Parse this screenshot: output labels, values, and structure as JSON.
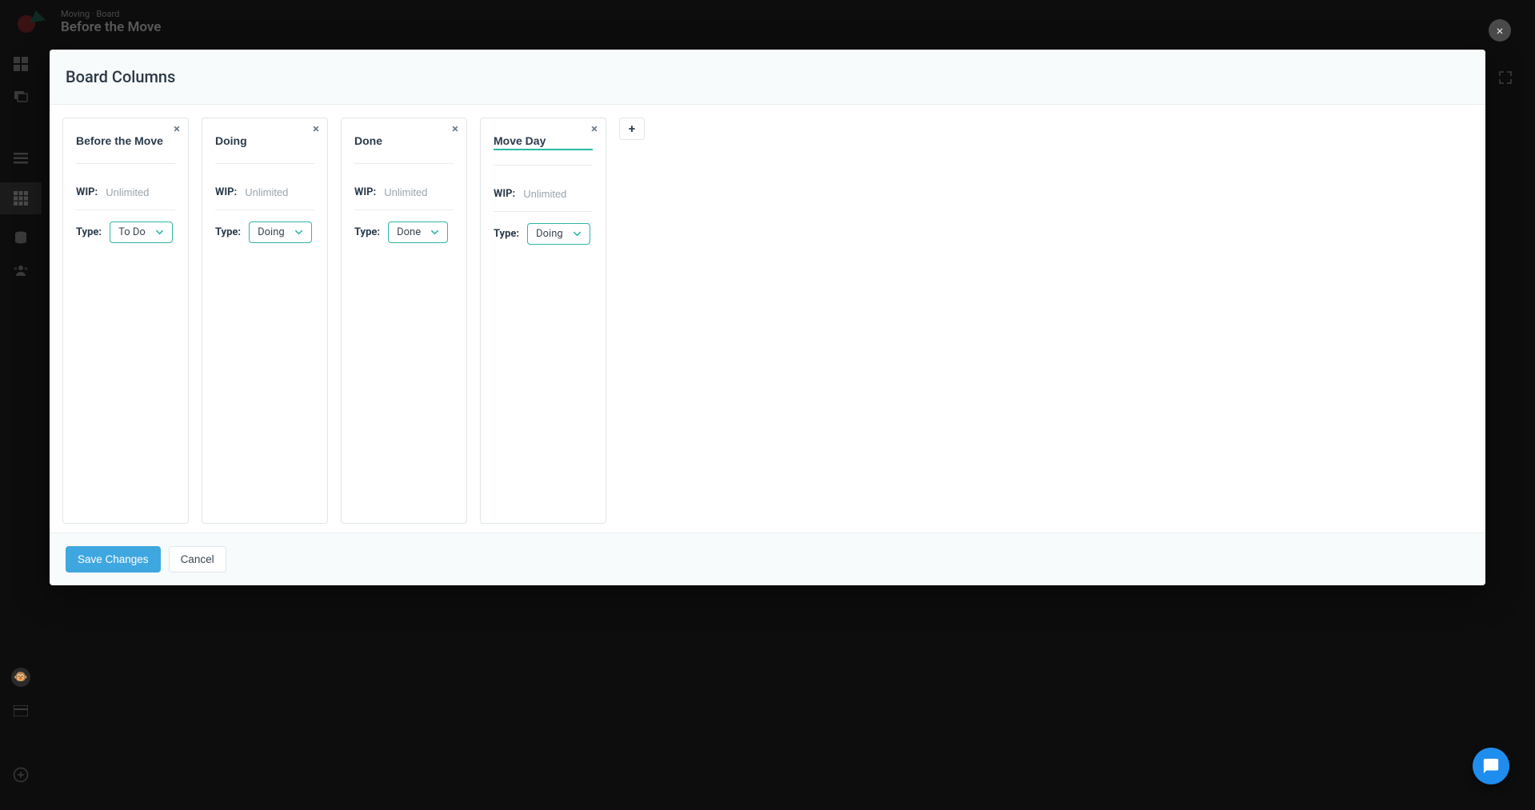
{
  "header": {
    "breadcrumb": "Moving · Board",
    "title": "Before the Move"
  },
  "modal": {
    "title": "Board Columns",
    "wip_label": "WIP:",
    "wip_placeholder": "Unlimited",
    "type_label": "Type:",
    "save_label": "Save Changes",
    "cancel_label": "Cancel"
  },
  "columns": [
    {
      "name": "Before the Move",
      "wip": "",
      "type": "To Do",
      "editing": false
    },
    {
      "name": "Doing",
      "wip": "",
      "type": "Doing",
      "editing": false
    },
    {
      "name": "Done",
      "wip": "",
      "type": "Done",
      "editing": false
    },
    {
      "name": "Move Day",
      "wip": "",
      "type": "Doing",
      "editing": true
    }
  ],
  "icons": {
    "close": "×",
    "plus": "+",
    "chevron_down": "⌄"
  }
}
